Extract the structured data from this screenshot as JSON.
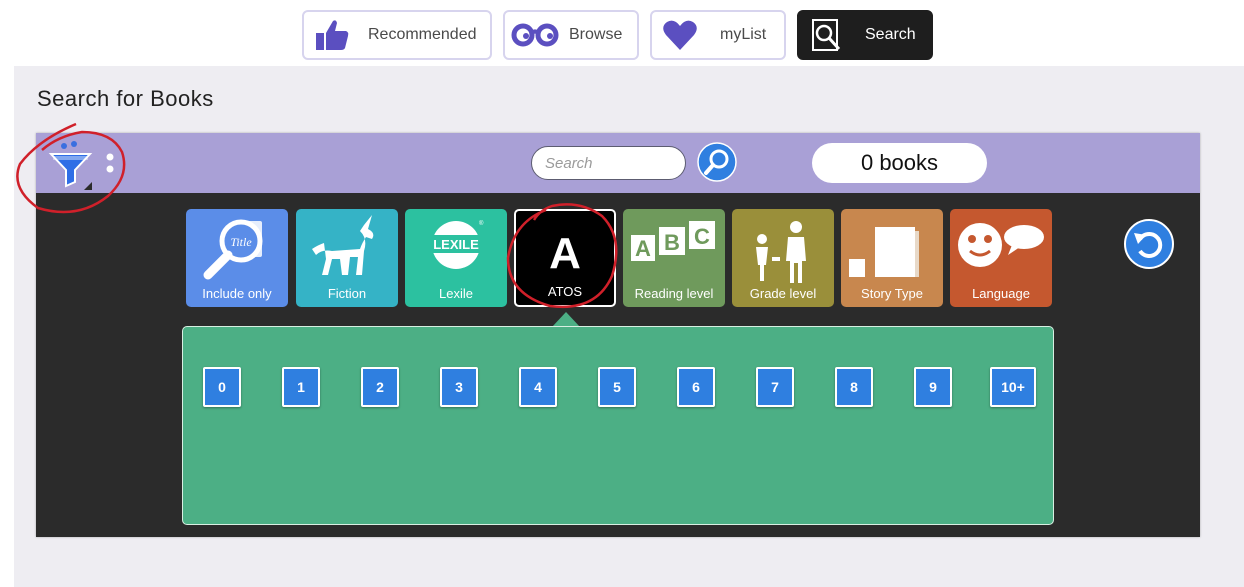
{
  "nav": {
    "items": [
      {
        "label": "Recommended",
        "icon": "thumbs-up-icon",
        "active": false
      },
      {
        "label": "Browse",
        "icon": "glasses-icon",
        "active": false
      },
      {
        "label": "myList",
        "icon": "heart-icon",
        "active": false
      },
      {
        "label": "Search",
        "icon": "search-book-icon",
        "active": true
      }
    ]
  },
  "page": {
    "title": "Search for Books"
  },
  "toolbar": {
    "search_placeholder": "Search",
    "book_count": "0 books"
  },
  "categories": [
    {
      "label": "Include only",
      "color": "#5b8de8",
      "icon": "title-magnifier-icon"
    },
    {
      "label": "Fiction",
      "color": "#35b3c6",
      "icon": "unicorn-icon"
    },
    {
      "label": "Lexile",
      "color": "#2cc1a0",
      "icon": "lexile-logo-icon",
      "logo_text": "LEXILE"
    },
    {
      "label": "ATOS",
      "color": "#000000",
      "icon": "letter-a-icon",
      "glyph": "A",
      "selected": true
    },
    {
      "label": "Reading level",
      "color": "#6f9a5c",
      "icon": "abc-blocks-icon",
      "glyphs": [
        "A",
        "B",
        "C"
      ]
    },
    {
      "label": "Grade level",
      "color": "#9a8f3a",
      "icon": "people-icon"
    },
    {
      "label": "Story Type",
      "color": "#c8874e",
      "icon": "books-icon"
    },
    {
      "label": "Language",
      "color": "#c5582f",
      "icon": "speech-face-icon"
    }
  ],
  "levels": [
    "0",
    "1",
    "2",
    "3",
    "4",
    "5",
    "6",
    "7",
    "8",
    "9",
    "10+"
  ],
  "colors": {
    "toolbar": "#a9a0d6",
    "panel": "#2b2b2b",
    "levels_panel": "#4caf85",
    "level_button": "#2f7fe0",
    "annotation": "#d0202a"
  }
}
